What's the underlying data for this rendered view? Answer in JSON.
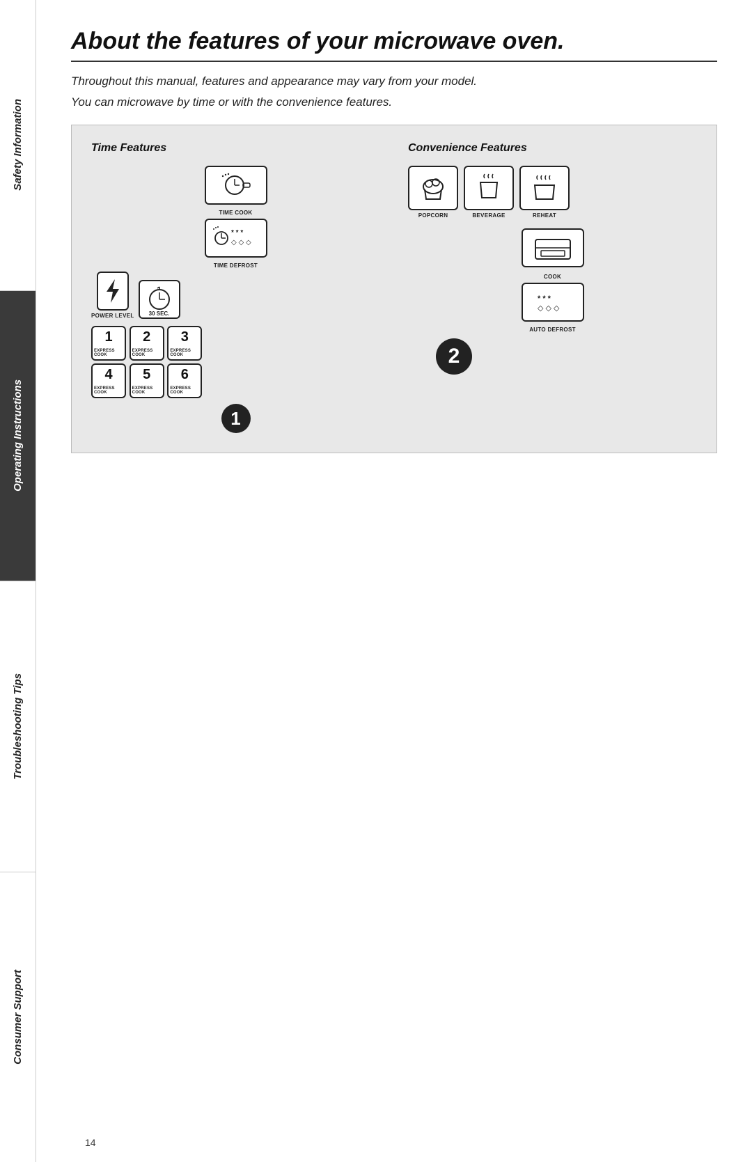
{
  "page": {
    "title": "About the features of your microwave oven.",
    "subtitle1": "Throughout this manual, features and appearance may vary from your model.",
    "subtitle2": "You can microwave by time or with the convenience features.",
    "page_number": "14"
  },
  "sidebar": {
    "sections": [
      {
        "label": "Safety Information",
        "dark": false
      },
      {
        "label": "Operating Instructions",
        "dark": true
      },
      {
        "label": "Troubleshooting Tips",
        "dark": false
      },
      {
        "label": "Consumer Support",
        "dark": false
      }
    ]
  },
  "time_features": {
    "title": "Time Features",
    "buttons": {
      "time_cook": "TIME COOK",
      "time_defrost": "TIME DEFROST",
      "power_level": "POWER LEVEL",
      "sec30": "30 SEC.",
      "express_cook": "EXPRESS COOK"
    },
    "express_numbers": [
      "1",
      "2",
      "3",
      "4",
      "5",
      "6"
    ],
    "badge1": "1"
  },
  "convenience_features": {
    "title": "Convenience Features",
    "buttons": {
      "popcorn": "POPCORN",
      "beverage": "BEVERAGE",
      "reheat": "REHEAT",
      "cook": "COOK",
      "auto_defrost": "AUTO DEFROST"
    },
    "badge2": "2"
  }
}
